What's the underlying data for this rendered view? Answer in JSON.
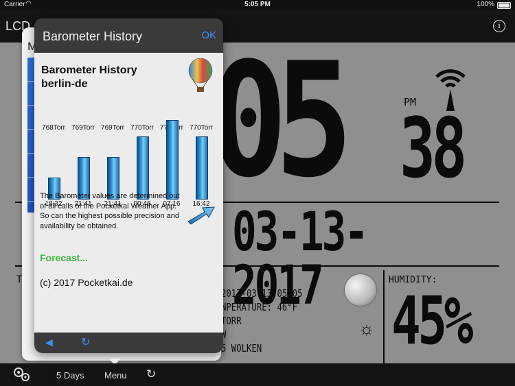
{
  "status_bar": {
    "carrier": "Carrier",
    "time": "5:05 PM",
    "battery": "100%"
  },
  "nav": {
    "title": "LCD"
  },
  "lcd": {
    "big_time": "05",
    "ampm": "PM",
    "seconds": "38",
    "date": "03-13-2017",
    "info_lines": [
      "2017-03-13 05:05",
      "NPERATURE: 46°F",
      "  TORR",
      "  W",
      "5 WOLKEN"
    ],
    "humidity_label": "HUMIDITY:",
    "humidity_value": "45%",
    "t_letter": "T"
  },
  "menu_panel": {
    "letter": "M"
  },
  "popover": {
    "title": "Barometer History",
    "ok_label": "OK",
    "content_title_line1": "Barometer History",
    "content_title_line2": "berlin-de",
    "bars": [
      {
        "top_label": "768Torr",
        "bottom_label": "18:32",
        "value": 768
      },
      {
        "top_label": "769Torr",
        "bottom_label": "21:41",
        "value": 769
      },
      {
        "top_label": "769Torr",
        "bottom_label": "21:41",
        "value": 769
      },
      {
        "top_label": "770Torr",
        "bottom_label": "00:46",
        "value": 770
      },
      {
        "top_label": "770Torr",
        "bottom_label": "07:16",
        "value": 770.8
      },
      {
        "top_label": "770Torr",
        "bottom_label": "16:42",
        "value": 770
      }
    ],
    "description": "The Barometer values are determined out of all calls of the Pocketkai Weather App. So can the highest possible precision and availability be obtained.",
    "forecast_link": "Forecast...",
    "copyright": "(c) 2017 Pocketkai.de"
  },
  "bottom_bar": {
    "days_label": "5 Days",
    "menu_label": "Menu"
  },
  "colors": {
    "accent": "#3b8ef5",
    "forecast": "#3fba3f",
    "bar": "#3aa3e0"
  }
}
